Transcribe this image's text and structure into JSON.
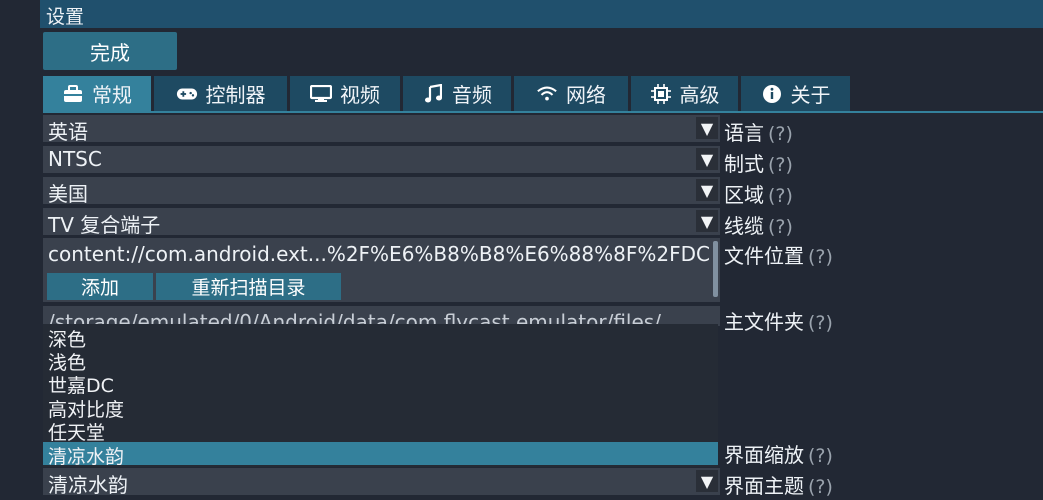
{
  "window": {
    "title": "设置"
  },
  "toolbar": {
    "done_label": "完成"
  },
  "tabs": [
    {
      "label": "常规",
      "icon": "toolbox-icon",
      "active": true
    },
    {
      "label": "控制器",
      "icon": "gamepad-icon"
    },
    {
      "label": "视频",
      "icon": "monitor-icon"
    },
    {
      "label": "音频",
      "icon": "music-note-icon"
    },
    {
      "label": "网络",
      "icon": "wifi-icon"
    },
    {
      "label": "高级",
      "icon": "chip-icon"
    },
    {
      "label": "关于",
      "icon": "info-icon"
    }
  ],
  "settings": {
    "language": {
      "value": "英语",
      "label": "语言",
      "help": "(?)"
    },
    "broadcast": {
      "value": "NTSC",
      "label": "制式",
      "help": "(?)"
    },
    "region": {
      "value": "美国",
      "label": "区域",
      "help": "(?)"
    },
    "cable": {
      "value": "TV 复合端子",
      "label": "线缆",
      "help": "(?)"
    },
    "content_location": {
      "value": "content://com.android.ext...%2F%E6%B8%B8%E6%88%8F%2FDC",
      "label": "文件位置",
      "help": "(?)",
      "add_label": "添加",
      "rescan_label": "重新扫描目录"
    },
    "home_folder": {
      "value": "/storage/emulated/0/Android/data/com.flycast.emulator/files/",
      "label": "主文件夹",
      "help": "(?)"
    },
    "ui_scale": {
      "label": "界面缩放",
      "help": "(?)"
    },
    "ui_theme": {
      "value": "清凉水韵",
      "label": "界面主题",
      "help": "(?)"
    }
  },
  "theme_options": [
    "深色",
    "浅色",
    "世嘉DC",
    "高对比度",
    "任天堂",
    "清凉水韵"
  ],
  "theme_selected_index": 5,
  "colors": {
    "accent": "#34819c",
    "tab": "#1e4a62",
    "titlebar": "#20506d",
    "field": "#3a414d"
  }
}
